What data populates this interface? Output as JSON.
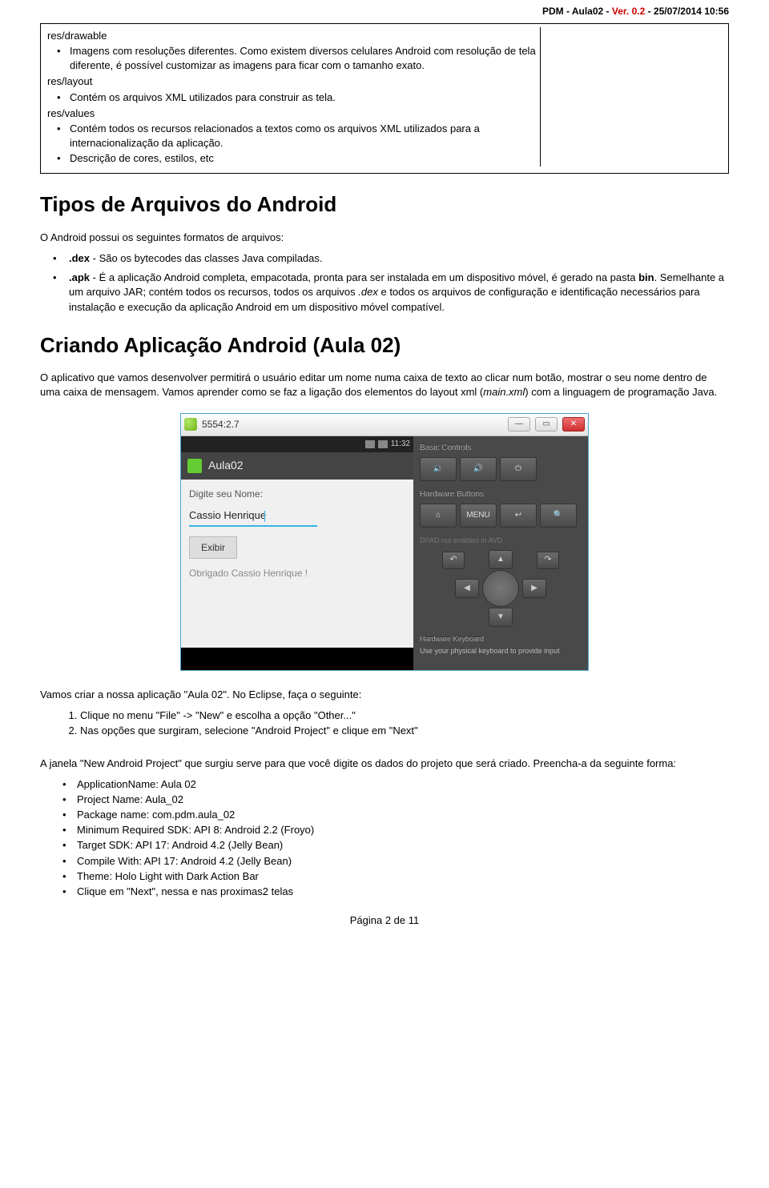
{
  "header": {
    "prefix": "PDM - Aula02 - ",
    "ver": "Ver. 0.2",
    "suffix": " - 25/07/2014 10:56"
  },
  "box": {
    "drawable_title": "res/drawable",
    "drawable_item": "Imagens com resoluções diferentes. Como existem diversos celulares Android com resolução de tela diferente, é possível customizar as imagens para ficar com o tamanho exato.",
    "layout_title": "res/layout",
    "layout_item": "Contém os arquivos XML utilizados para construir as tela.",
    "values_title": "res/values",
    "values_item1": "Contém todos os recursos relacionados a textos como os arquivos XML utilizados para a internacionalização da aplicação.",
    "values_item2": "Descrição de cores, estilos, etc"
  },
  "h1a": "Tipos de Arquivos do Android",
  "p1": "O Android possui os seguintes formatos de arquivos:",
  "li_dex_b": ".dex",
  "li_dex_t": " - São os bytecodes das classes Java compiladas.",
  "li_apk_b": ".apk",
  "li_apk_t1": " - É a aplicação Android completa, empacotada, pronta para ser instalada em um dispositivo móvel, é gerado na pasta ",
  "li_apk_bin": "bin",
  "li_apk_t2": ". Semelhante a um arquivo JAR; contém todos os recursos, todos os arquivos ",
  "li_apk_i": ".dex",
  "li_apk_t3": " e todos os arquivos de configuração e identificação necessários para instalação e execução da aplicação Android em um dispositivo móvel compatível.",
  "h1b": "Criando Aplicação Android (Aula 02)",
  "p2a": "O aplicativo que vamos desenvolver permitirá o usuário editar um nome numa caixa de texto ao clicar num botão, mostrar o seu nome dentro de uma caixa de mensagem. Vamos aprender como se faz a ligação dos elementos do layout xml (",
  "p2i": "main.xml",
  "p2b": ") com a linguagem de programação Java.",
  "emul": {
    "title": "5554:2.7",
    "status_time": "11:32",
    "app_name": "Aula02",
    "label": "Digite seu Nome:",
    "input_value": "Cassio Henrique",
    "button": "Exibir",
    "msg": "Obrigado Cassio Henrique !",
    "basic": "Basic Controls",
    "hw": "Hardware Buttons",
    "menu": "MENU",
    "dpad_note": "DPAD not enabled in AVD",
    "kb_hdr": "Hardware Keyboard",
    "kb_txt": "Use your physical keyboard to provide input"
  },
  "p3": "Vamos criar a nossa aplicação \"Aula 02\". No Eclipse, faça o seguinte:",
  "ol1": "Clique no menu \"File\" -> \"New\" e escolha a opção \"Other...\"",
  "ol2": "Nas opções que surgiram, selecione \"Android Project\" e clique em \"Next\"",
  "p4": "A janela \"New Android Project\" que surgiu serve para que você digite os dados do projeto que será criado. Preencha-a da seguinte forma:",
  "form": {
    "a": "ApplicationName: Aula 02",
    "b": "Project Name: Aula_02",
    "c": "Package name: com.pdm.aula_02",
    "d": "Minimum Required SDK: API 8: Android 2.2 (Froyo)",
    "e": "Target SDK: API 17: Android 4.2 (Jelly Bean)",
    "f": "Compile With: API 17: Android 4.2 (Jelly Bean)",
    "g": "Theme: Holo Light with Dark Action Bar",
    "h": "Clique em \"Next\", nessa e nas proximas2 telas"
  },
  "footer": "Página 2 de 11"
}
